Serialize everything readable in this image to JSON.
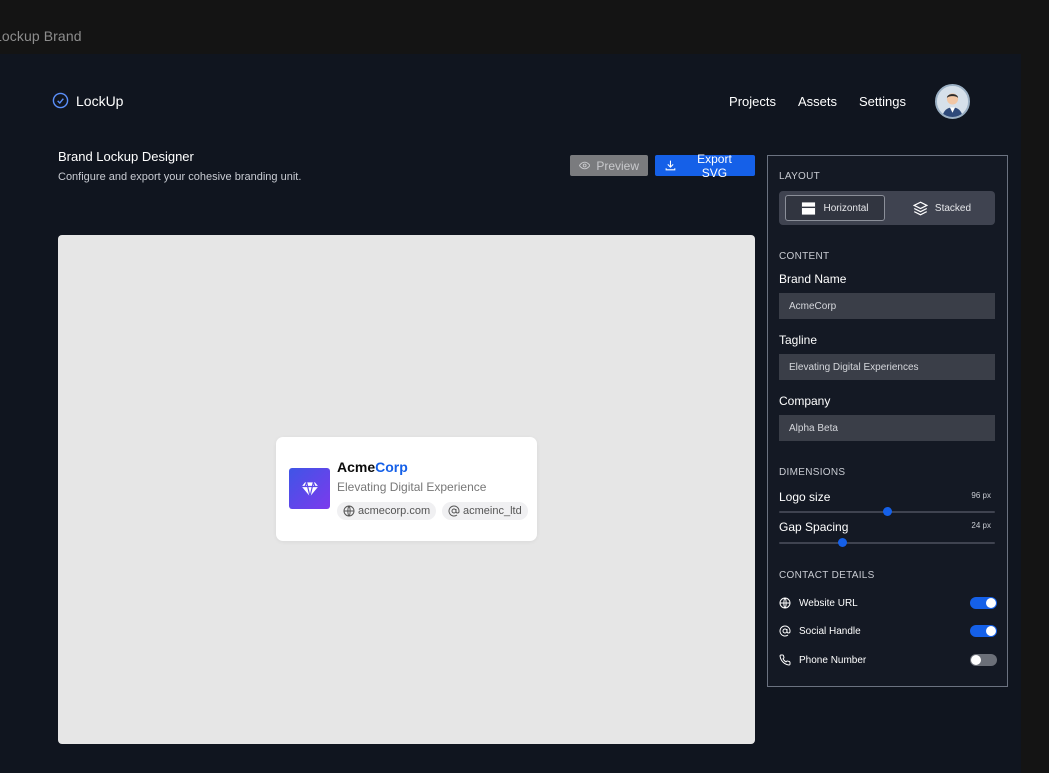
{
  "window": {
    "title": "Lockup Brand"
  },
  "header": {
    "logo_text": "LockUp",
    "nav": [
      "Projects",
      "Assets",
      "Settings"
    ]
  },
  "page": {
    "title": "Brand Lockup Designer",
    "subtitle": "Configure and export your cohesive branding unit.",
    "preview_label": "Preview",
    "export_label": "Export SVG"
  },
  "preview_card": {
    "brand_name_part1": "Acme",
    "brand_name_part2": "Corp",
    "tagline": "Elevating Digital Experience",
    "website": "acmecorp.com",
    "social": "acmeinc_ltd"
  },
  "panel": {
    "layout_label": "LAYOUT",
    "layout_options": [
      "Horizontal",
      "Stacked"
    ],
    "layout_selected": "Horizontal",
    "content_label": "CONTENT",
    "brand_name_label": "Brand Name",
    "brand_name_value": "AcmeCorp",
    "tagline_label": "Tagline",
    "tagline_value": "Elevating Digital Experiences",
    "company_label": "Company",
    "company_value": "Alpha Beta",
    "dimensions_label": "DIMENSIONS",
    "logo_size_label": "Logo size",
    "logo_size_value": "96 px",
    "logo_size_fraction": 0.5,
    "gap_label": "Gap Spacing",
    "gap_value": "24 px",
    "gap_fraction": 0.29,
    "contact_label": "CONTACT DETAILS",
    "contacts": [
      {
        "label": "Website URL",
        "enabled": true
      },
      {
        "label": "Social Handle",
        "enabled": true
      },
      {
        "label": "Phone Number",
        "enabled": false
      }
    ]
  },
  "colors": {
    "accent": "#1560e8",
    "background": "#10151f",
    "canvas": "#e6e6e6"
  }
}
